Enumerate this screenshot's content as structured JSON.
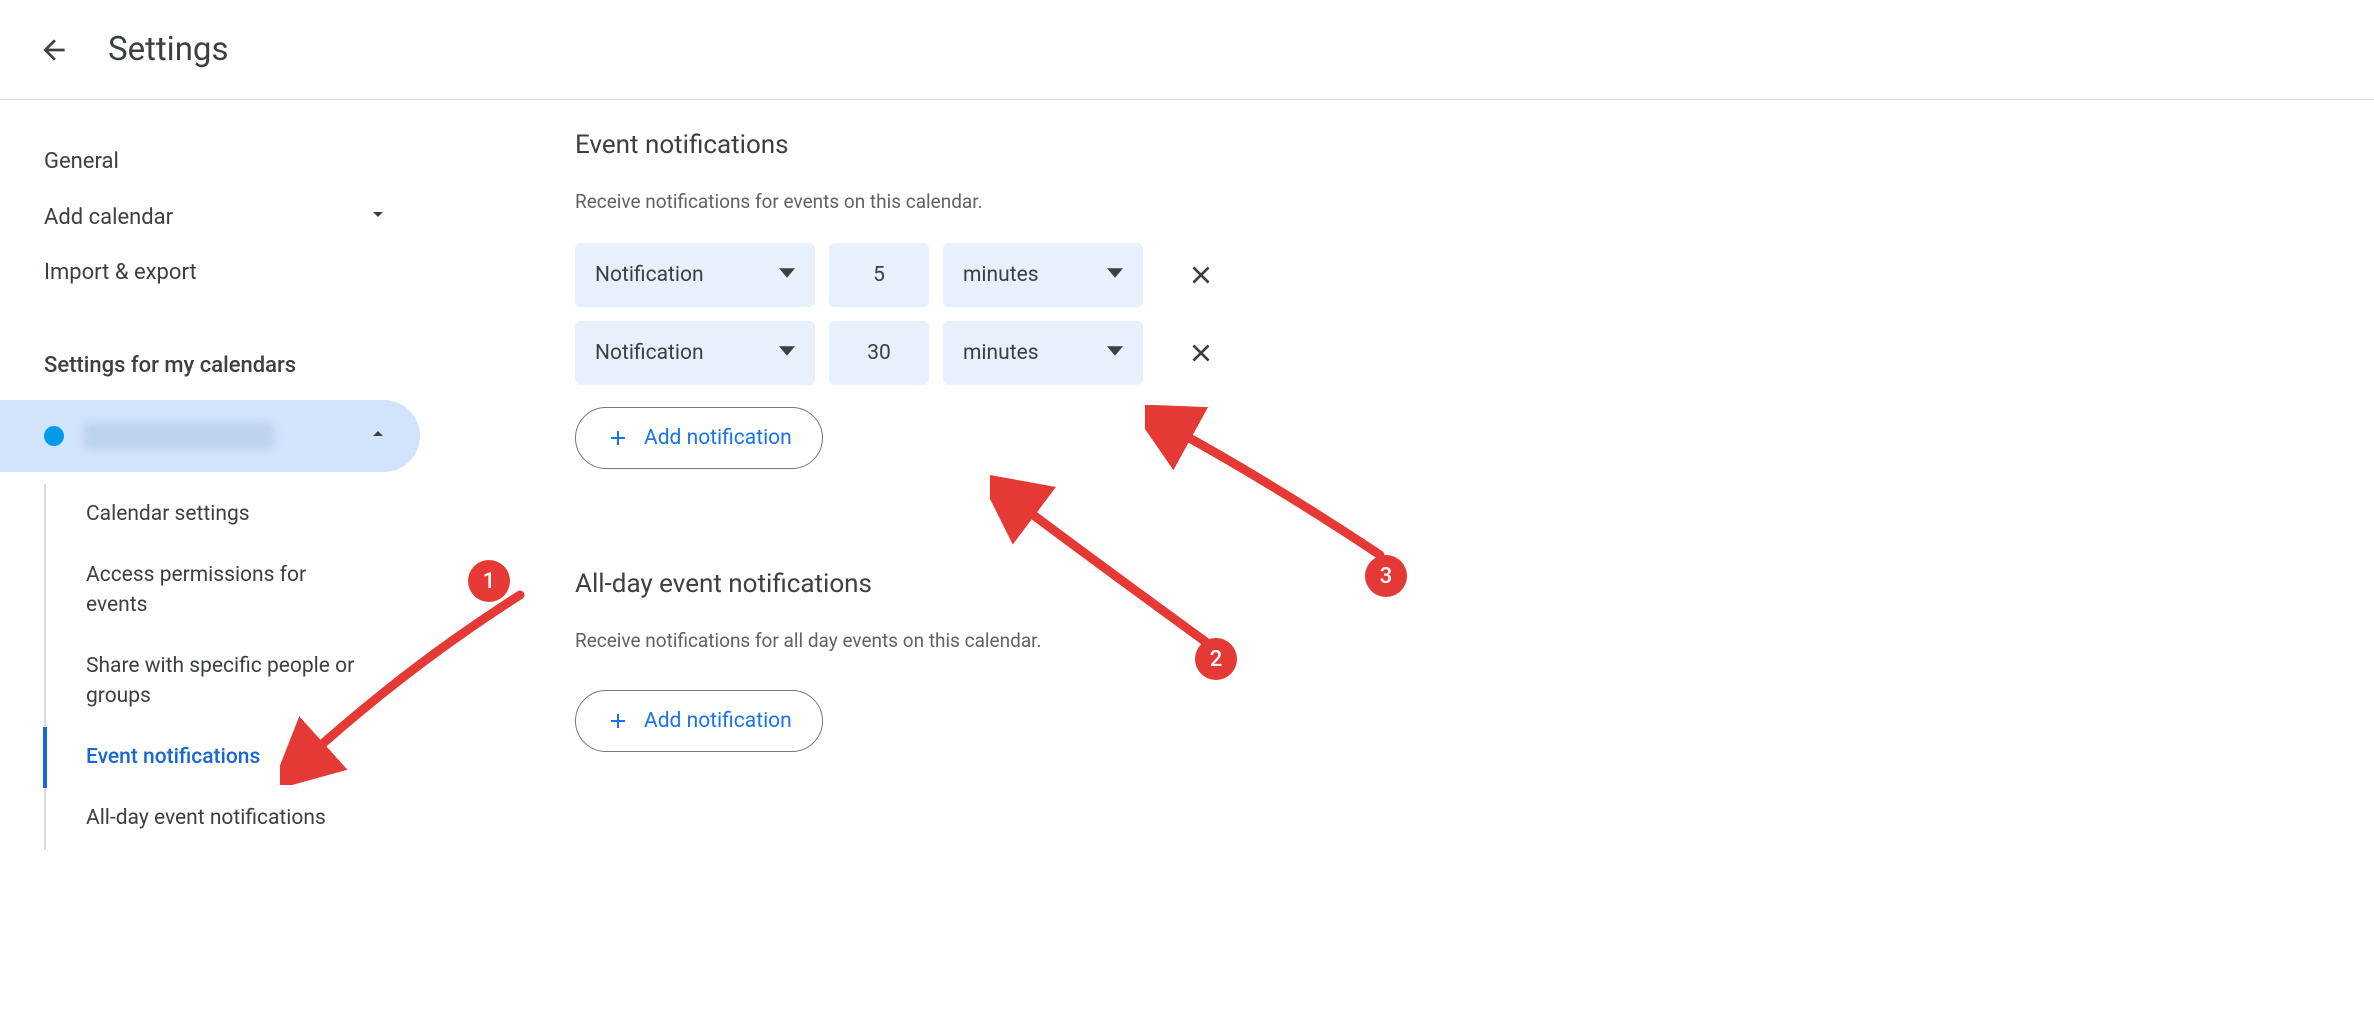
{
  "header": {
    "title": "Settings"
  },
  "sidebar": {
    "general": "General",
    "add_calendar": "Add calendar",
    "import_export": "Import & export",
    "my_calendars_heading": "Settings for my calendars",
    "subitems": {
      "calendar_settings": "Calendar settings",
      "access_permissions": "Access permissions for events",
      "share_specific": "Share with specific people or groups",
      "event_notifications": "Event notifications",
      "allday_notifications": "All-day event notifications"
    }
  },
  "main": {
    "event_notifications": {
      "title": "Event notifications",
      "desc": "Receive notifications for events on this calendar.",
      "rows": [
        {
          "method": "Notification",
          "value": "5",
          "unit": "minutes"
        },
        {
          "method": "Notification",
          "value": "30",
          "unit": "minutes"
        }
      ],
      "add_label": "Add notification"
    },
    "allday_notifications": {
      "title": "All-day event notifications",
      "desc": "Receive notifications for all day events on this calendar.",
      "add_label": "Add notification"
    }
  },
  "annotations": {
    "m1": "1",
    "m2": "2",
    "m3": "3"
  }
}
